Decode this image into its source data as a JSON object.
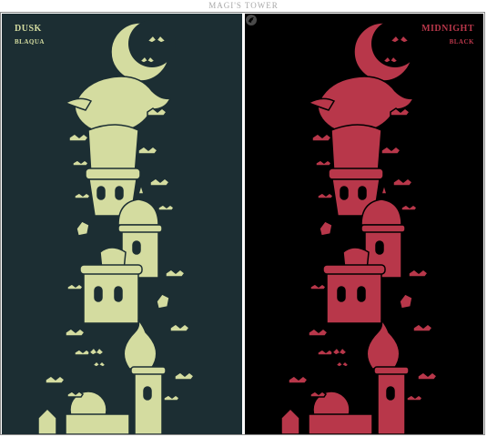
{
  "page": {
    "title": "MAGI'S TOWER"
  },
  "panels": [
    {
      "title": "DUSK",
      "subtitle": "BLAQUA",
      "background": "#1c2e33",
      "ink": "#d4dca0"
    },
    {
      "title": "MIDNIGHT",
      "subtitle": "BLACK",
      "background": "#000000",
      "ink": "#b8374a"
    }
  ],
  "icons": {
    "corner_logo": "dragon-logo-icon"
  }
}
